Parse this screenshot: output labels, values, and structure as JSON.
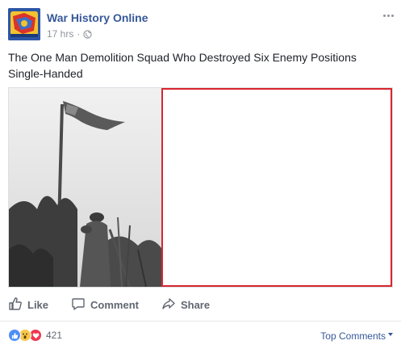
{
  "post": {
    "page_name": "War History Online",
    "time": "17 hrs",
    "separator": "·",
    "privacy_icon": "globe-icon",
    "text": "The One Man Demolition Squad Who Destroyed Six Enemy Positions Single-Handed"
  },
  "actions": {
    "like_label": "Like",
    "comment_label": "Comment",
    "share_label": "Share"
  },
  "footer": {
    "reaction_icons": [
      "like-icon",
      "wow-icon",
      "love-icon"
    ],
    "reaction_count": "421",
    "top_comments_label": "Top Comments"
  },
  "colors": {
    "link_blue": "#365899",
    "meta_gray": "#90949c",
    "highlight_red": "#d9262f"
  }
}
